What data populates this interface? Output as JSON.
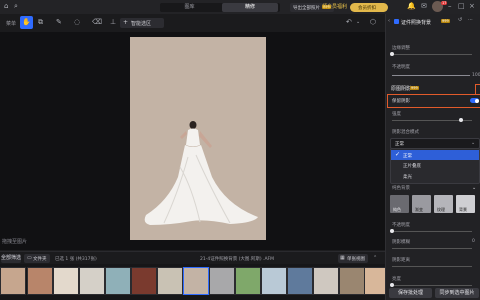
{
  "topbar": {
    "tab_left": "图库",
    "tab_active": "精修",
    "tab_export": "导出全部照片",
    "export_badge": "999",
    "vip_label": "领会员福利",
    "member_label": "会员折扣",
    "badge_count": "17"
  },
  "toolbar": {
    "label_left": "菜单",
    "smart_select_label": "智能选区"
  },
  "statusbar": {
    "text": "拖拽至图片"
  },
  "filmstrip": {
    "filter_all": "全部筛选",
    "folder_btn": "文件夹",
    "selected_info": "已选 1 张 (共317张)",
    "filename": "21-4证件照换背景 (大图.阿斯) .AFM",
    "single_view": "单张视图"
  },
  "panel": {
    "title": "证件照换背景",
    "title_badge": "999",
    "edge_adjust": "边缘调整",
    "opacity": "不透明度",
    "opacity_value": "100",
    "shadow_section": "原图阴影",
    "shadow_badge": "999",
    "keep_shadow": "保留阴影",
    "intensity": "强度",
    "blend_mode_label": "阴影混合模式",
    "blend_mode_value": "正常",
    "blend_options": [
      "正常",
      "正片叠底",
      "柔光"
    ],
    "bg_type_label": "纯色背景",
    "bg_presets": [
      "纯色",
      "渐变",
      "纹理",
      "背景"
    ],
    "opacity2": "不透明度",
    "shadow_blur": "阴影模糊",
    "shadow_blur_value": "0",
    "shadow_distance": "阴影距离",
    "brightness": "亮度",
    "batch_btn": "保存批处理",
    "sync_btn": "同步到选中图片"
  },
  "colors": {
    "accent": "#2f6bff",
    "selected_bg": "#2e5fd8",
    "photo_bg": "#c3b3a5"
  },
  "icons": [
    "home-icon",
    "search-icon",
    "undo-icon",
    "eye-icon",
    "cube-icon",
    "gear-icon"
  ]
}
